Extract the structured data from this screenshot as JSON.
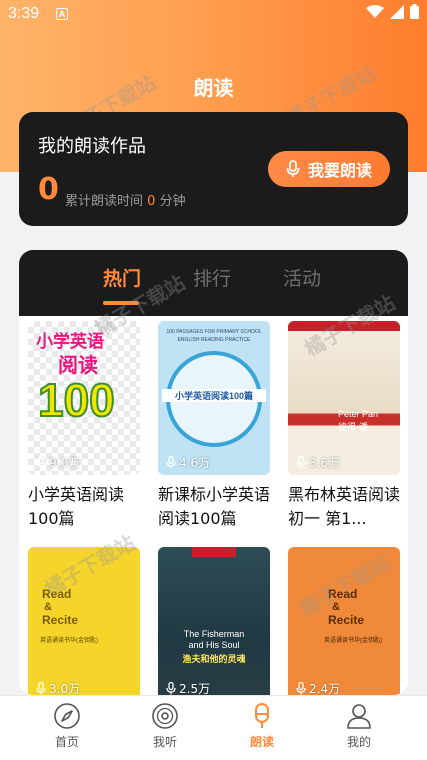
{
  "status": {
    "time": "3:39",
    "a_badge": "A"
  },
  "header": {
    "title": "朗读"
  },
  "works": {
    "title": "我的朗读作品",
    "count": "0",
    "sub_prefix": "累计朗读时间",
    "sub_value": "0",
    "sub_suffix": "分钟",
    "button_label": "我要朗读"
  },
  "tabs": [
    {
      "label": "热门",
      "active": true
    },
    {
      "label": "排行",
      "active": false
    },
    {
      "label": "活动",
      "active": false
    }
  ],
  "books": [
    {
      "title": "小学英语阅读100篇",
      "plays": "9.0万",
      "cover_text": [
        "小学英语",
        "阅读",
        "100"
      ]
    },
    {
      "title": "新课标小学英语阅读100篇",
      "plays": "4.6万",
      "cover_text": [
        "100 PASSAGES FOR PRIMARY SCHOOL",
        "ENGLISH READING PRACTICE",
        "小学英语阅读100篇"
      ]
    },
    {
      "title": "黑布林英语阅读 初一 第1...",
      "plays": "3.6万",
      "cover_text": [
        "Peter Pan",
        "彼得·潘"
      ]
    },
    {
      "title": "",
      "plays": "3.0万",
      "cover_text": [
        "Read",
        "&",
        "Recite",
        "英语诵读书华(金钥匙)"
      ]
    },
    {
      "title": "",
      "plays": "2.5万",
      "cover_text": [
        "The Fisherman",
        "and His Soul",
        "渔夫和他的灵魂"
      ]
    },
    {
      "title": "",
      "plays": "2.4万",
      "cover_text": [
        "Read",
        "&",
        "Recite",
        "英语诵读书华(金钥匙)"
      ]
    }
  ],
  "nav": [
    {
      "label": "首页",
      "icon": "compass-icon",
      "active": false
    },
    {
      "label": "我听",
      "icon": "vinyl-icon",
      "active": false
    },
    {
      "label": "朗读",
      "icon": "microphone-icon",
      "active": true
    },
    {
      "label": "我的",
      "icon": "user-icon",
      "active": false
    }
  ],
  "watermark": "橘子下载站",
  "colors": {
    "accent": "#ff8a3c",
    "dark_card": "#1b1b1c"
  }
}
